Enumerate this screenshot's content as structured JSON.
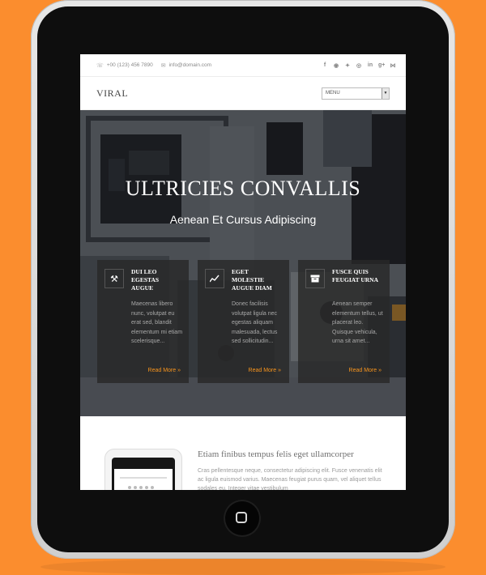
{
  "topbar": {
    "phone": "+00 (123) 456 7890",
    "email": "info@domain.com",
    "phone_icon": "phone-icon",
    "email_icon": "mail-icon",
    "socials": [
      "facebook-icon",
      "pinterest-icon",
      "twitter-icon",
      "dribbble-icon",
      "linkedin-icon",
      "google-plus-icon",
      "rss-icon"
    ],
    "social_glyphs": [
      "f",
      "p",
      "t",
      "d",
      "in",
      "g+",
      "r"
    ]
  },
  "header": {
    "logo": "VIRAL",
    "menu_label": "MENU"
  },
  "hero": {
    "title": "ULTRICIES CONVALLIS",
    "subtitle": "Aenean Et Cursus Adipiscing"
  },
  "cards": [
    {
      "icon": "gavel-icon",
      "title": "DUI LEO EGESTAS AUGUE",
      "text": "Maecenas libero nunc, volutpat eu erat sed, blandit elementum mi etiam scelerisque...",
      "more": "Read More »"
    },
    {
      "icon": "chart-line-icon",
      "title": "EGET MOLESTIE AUGUE DIAM",
      "text": "Donec facilisis volutpat ligula nec egestas aliquam malesuada, lectus sed sollicitudin...",
      "more": "Read More »"
    },
    {
      "icon": "archive-icon",
      "title": "FUSCE QUIS FEUGIAT URNA",
      "text": "Aenean semper elementum tellus, ut placerat leo. Quisque vehicula, urna sit amet...",
      "more": "Read More »"
    }
  ],
  "feature": {
    "title": "Etiam finibus tempus felis eget ullamcorper",
    "text": "Cras pellentesque neque, consectetur adipiscing elit. Fusce venenatis elit ac ligula euismod varius. Maecenas feugiat purus quam, vel aliquet tellus sodales eu. Integer vitae vestibulum"
  },
  "colors": {
    "background": "#fb8d2e",
    "accent": "#f7941d",
    "device": "#0e0e0e"
  }
}
